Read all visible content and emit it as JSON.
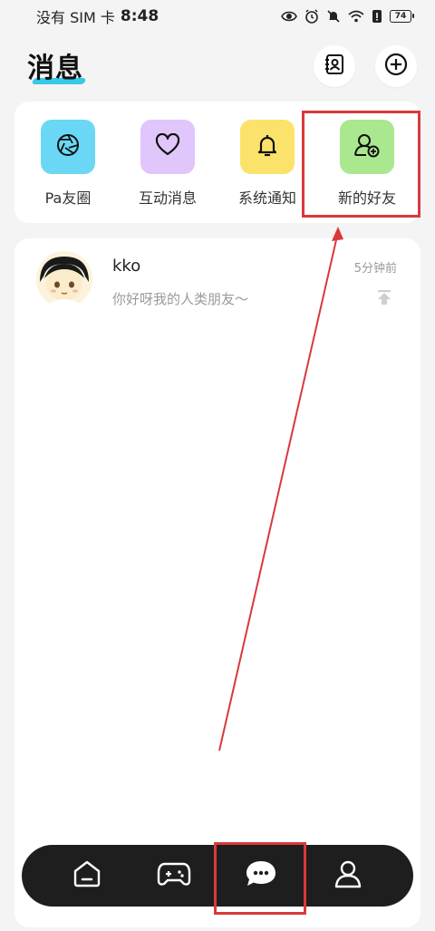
{
  "status_bar": {
    "carrier": "没有 SIM 卡",
    "time": "8:48",
    "battery": "74"
  },
  "header": {
    "title": "消息"
  },
  "quick_actions": [
    {
      "label": "Pa友圈",
      "icon": "camera-aperture-icon",
      "color": "#6ad8f5"
    },
    {
      "label": "互动消息",
      "icon": "heart-icon",
      "color": "#e0c6fb"
    },
    {
      "label": "系统通知",
      "icon": "bell-icon",
      "color": "#fbe36b"
    },
    {
      "label": "新的好友",
      "icon": "add-friend-icon",
      "color": "#a9e88f"
    }
  ],
  "chats": [
    {
      "name": "kko",
      "preview": "你好呀我的人类朋友～",
      "time": "5分钟前"
    }
  ],
  "bottom_nav": [
    {
      "icon": "home-icon"
    },
    {
      "icon": "gamepad-icon"
    },
    {
      "icon": "message-icon",
      "active": true
    },
    {
      "icon": "profile-icon"
    }
  ],
  "annotation_color": "#d9393b"
}
